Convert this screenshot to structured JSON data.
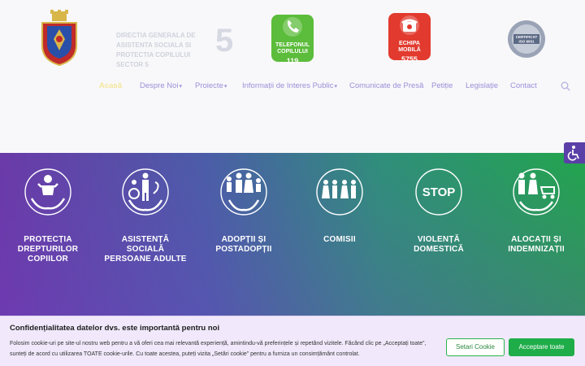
{
  "header": {
    "logo_alt_text": "DIRECTIA GENERALA DE ASISTENTA SOCIALA SI PROTECTIA COPILULUI SECTOR 5",
    "logo_number": "5",
    "child_phone": {
      "line1": "TELEFONUL",
      "line2": "COPILULUI",
      "number": "119",
      "color": "#5cbc3b"
    },
    "mobile_team": {
      "line1": "ECHIPA",
      "line2": "MOBILĂ",
      "number": "5755",
      "color": "#e23a2e"
    },
    "certificate": {
      "line1": "CERTIFICAT",
      "line2": "ISO 9001"
    }
  },
  "nav": {
    "items": [
      {
        "label": "Acasă",
        "has_dropdown": false
      },
      {
        "label": "Despre Noi",
        "has_dropdown": true
      },
      {
        "label": "Proiecte",
        "has_dropdown": true
      },
      {
        "label": "Informații de Interes Public",
        "has_dropdown": true
      },
      {
        "label": "Comunicate de Presă",
        "has_dropdown": false
      },
      {
        "label": "Petiție",
        "has_dropdown": false
      },
      {
        "label": "Legislație",
        "has_dropdown": false
      },
      {
        "label": "Contact",
        "has_dropdown": false
      }
    ],
    "chevron": "▾",
    "search_icon": "search-icon"
  },
  "services": [
    {
      "label": "PROTECȚIA DREPTURILOR COPIILOR",
      "icon": "child-protection-icon"
    },
    {
      "label": "ASISTENȚĂ SOCIALĂ PERSOANE ADULTE",
      "icon": "adult-assistance-icon"
    },
    {
      "label": "ADOPȚII ȘI POSTADOPȚII",
      "icon": "adoption-icon"
    },
    {
      "label": "COMISII",
      "icon": "committees-icon"
    },
    {
      "label": "VIOLENȚĂ DOMESTICĂ",
      "icon": "stop-violence-icon",
      "icon_text": "STOP"
    },
    {
      "label": "ALOCAȚII ȘI INDEMNIZAȚII",
      "icon": "allowances-icon"
    }
  ],
  "accessibility": {
    "icon": "wheelchair-icon"
  },
  "cookie": {
    "title": "Confidențialitatea datelor dvs. este importantă pentru noi",
    "body": "Folosim cookie-uri pe site-ul nostru web pentru a vă oferi cea mai relevantă experiență, amintindu-vă preferințele și repetând vizitele. Făcând clic pe „Acceptați toate”, sunteți de acord cu utilizarea TOATE cookie-urile. Cu toate acestea, puteți vizita „Setări cookie” pentru a furniza un consimțământ controlat.",
    "settings_label": "Setari Cookie",
    "accept_label": "Acceptare toate"
  }
}
